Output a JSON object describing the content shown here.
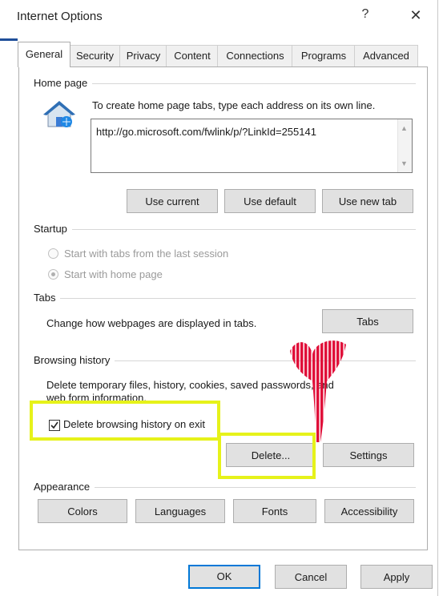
{
  "window": {
    "title": "Internet Options",
    "help": "?",
    "close": "✕"
  },
  "tabs": [
    {
      "label": "General",
      "active": true
    },
    {
      "label": "Security"
    },
    {
      "label": "Privacy"
    },
    {
      "label": "Content"
    },
    {
      "label": "Connections"
    },
    {
      "label": "Programs"
    },
    {
      "label": "Advanced"
    }
  ],
  "home_page": {
    "section": "Home page",
    "instruction": "To create home page tabs, type each address on its own line.",
    "url": "http://go.microsoft.com/fwlink/p/?LinkId=255141",
    "buttons": {
      "use_current": "Use current",
      "use_default": "Use default",
      "use_new_tab": "Use new tab"
    }
  },
  "startup": {
    "section": "Startup",
    "option_last_session": "Start with tabs from the last session",
    "option_home_page": "Start with home page",
    "selected": "home_page"
  },
  "tabs_section": {
    "section": "Tabs",
    "description": "Change how webpages are displayed in tabs.",
    "button": "Tabs"
  },
  "browsing_history": {
    "section": "Browsing history",
    "description_line1": "Delete temporary files, history, cookies, saved passwords, and",
    "description_line2": "web form information.",
    "checkbox_label": "Delete browsing history on exit",
    "checkbox_checked": true,
    "delete_button": "Delete...",
    "settings_button": "Settings"
  },
  "appearance": {
    "section": "Appearance",
    "buttons": {
      "colors": "Colors",
      "languages": "Languages",
      "fonts": "Fonts",
      "accessibility": "Accessibility"
    }
  },
  "footer": {
    "ok": "OK",
    "cancel": "Cancel",
    "apply": "Apply"
  },
  "colors": {
    "highlight": "#e6f21a",
    "annotation_red": "#e0103a",
    "default_button_border": "#0078d7"
  }
}
